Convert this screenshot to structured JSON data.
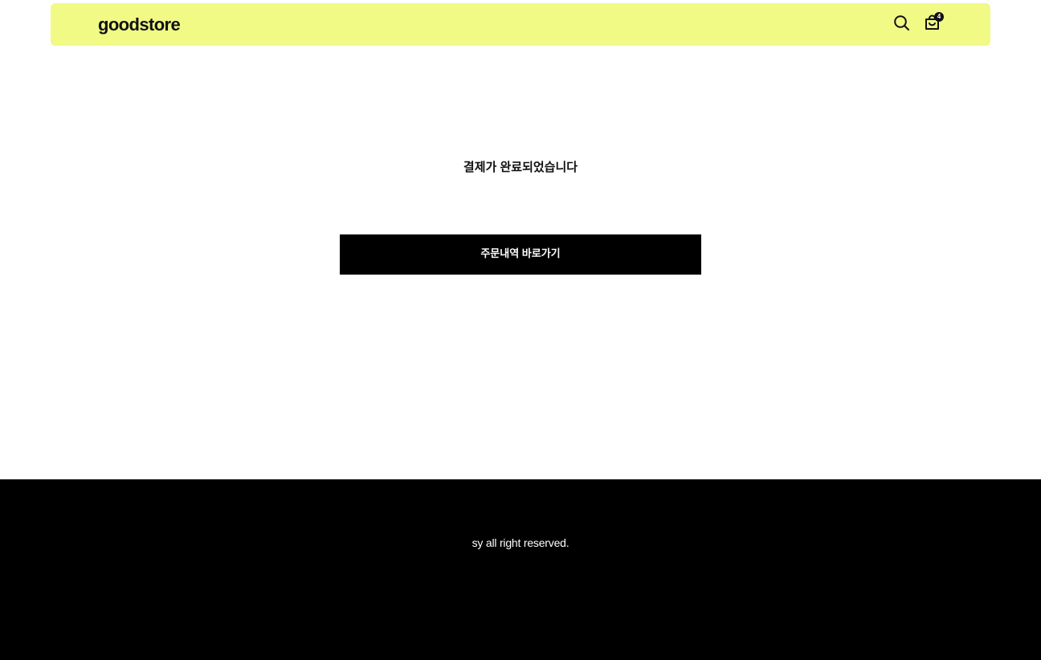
{
  "header": {
    "logo": "goodstore",
    "search_icon": "search-icon",
    "cart_icon": "shopping-bag-icon",
    "cart_count": "4"
  },
  "main": {
    "message": "결제가 완료되었습니다",
    "order_history_button": "주문내역 바로가기"
  },
  "footer": {
    "copyright": "sy all right reserved."
  },
  "colors": {
    "header_background": "#f0fa85",
    "button_background": "#000000",
    "footer_background": "#000000"
  }
}
